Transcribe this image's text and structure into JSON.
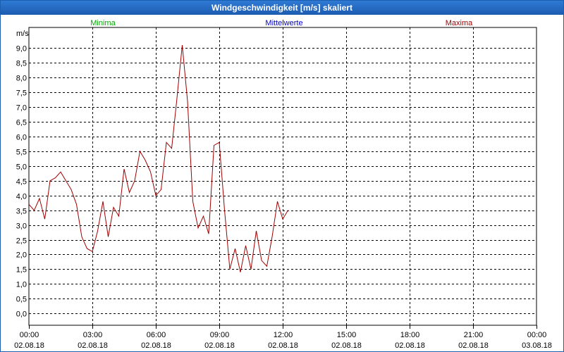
{
  "window": {
    "title": "Windgeschwindigkeit [m/s] skaliert"
  },
  "chart_data": {
    "type": "line",
    "title": "Windgeschwindigkeit [m/s] skaliert",
    "ylabel": "m/s",
    "xlabel": "",
    "ylim": [
      -0.4,
      9.7
    ],
    "xlim_hours": [
      0,
      24
    ],
    "grid": true,
    "yticks": [
      {
        "value": 0.0,
        "label": "0,0"
      },
      {
        "value": 0.5,
        "label": "0,5"
      },
      {
        "value": 1.0,
        "label": "1,0"
      },
      {
        "value": 1.5,
        "label": "1,5"
      },
      {
        "value": 2.0,
        "label": "2,0"
      },
      {
        "value": 2.5,
        "label": "2,5"
      },
      {
        "value": 3.0,
        "label": "3,0"
      },
      {
        "value": 3.5,
        "label": "3,5"
      },
      {
        "value": 4.0,
        "label": "4,0"
      },
      {
        "value": 4.5,
        "label": "4,5"
      },
      {
        "value": 5.0,
        "label": "5,0"
      },
      {
        "value": 5.5,
        "label": "5,5"
      },
      {
        "value": 6.0,
        "label": "6,0"
      },
      {
        "value": 6.5,
        "label": "6,5"
      },
      {
        "value": 7.0,
        "label": "7,0"
      },
      {
        "value": 7.5,
        "label": "7,5"
      },
      {
        "value": 8.0,
        "label": "8,0"
      },
      {
        "value": 8.5,
        "label": "8,5"
      },
      {
        "value": 9.0,
        "label": "9,0"
      }
    ],
    "xticks": [
      {
        "hour": 0,
        "time": "00:00",
        "date": "02.08.18"
      },
      {
        "hour": 3,
        "time": "03:00",
        "date": "02.08.18"
      },
      {
        "hour": 6,
        "time": "06:00",
        "date": "02.08.18"
      },
      {
        "hour": 9,
        "time": "09:00",
        "date": "02.08.18"
      },
      {
        "hour": 12,
        "time": "12:00",
        "date": "02.08.18"
      },
      {
        "hour": 15,
        "time": "15:00",
        "date": "02.08.18"
      },
      {
        "hour": 18,
        "time": "18:00",
        "date": "02.08.18"
      },
      {
        "hour": 21,
        "time": "21:00",
        "date": "02.08.18"
      },
      {
        "hour": 24,
        "time": "00:00",
        "date": "03.08.18"
      }
    ],
    "legend": [
      "Minima",
      "Mittelwerte",
      "Maxima"
    ],
    "series": [
      {
        "name": "Maxima",
        "color": "#a00000",
        "points": [
          [
            0.0,
            3.7
          ],
          [
            0.25,
            3.5
          ],
          [
            0.5,
            3.9
          ],
          [
            0.75,
            3.2
          ],
          [
            1.0,
            4.5
          ],
          [
            1.25,
            4.6
          ],
          [
            1.5,
            4.8
          ],
          [
            1.75,
            4.5
          ],
          [
            2.0,
            4.2
          ],
          [
            2.25,
            3.7
          ],
          [
            2.5,
            2.6
          ],
          [
            2.75,
            2.2
          ],
          [
            3.0,
            2.1
          ],
          [
            3.25,
            2.8
          ],
          [
            3.5,
            3.8
          ],
          [
            3.75,
            2.6
          ],
          [
            4.0,
            3.6
          ],
          [
            4.25,
            3.3
          ],
          [
            4.5,
            4.9
          ],
          [
            4.75,
            4.1
          ],
          [
            5.0,
            4.5
          ],
          [
            5.25,
            5.5
          ],
          [
            5.5,
            5.2
          ],
          [
            5.75,
            4.8
          ],
          [
            6.0,
            4.0
          ],
          [
            6.25,
            4.2
          ],
          [
            6.5,
            5.8
          ],
          [
            6.75,
            5.6
          ],
          [
            7.0,
            7.3
          ],
          [
            7.25,
            9.1
          ],
          [
            7.5,
            7.2
          ],
          [
            7.75,
            3.8
          ],
          [
            8.0,
            2.9
          ],
          [
            8.25,
            3.3
          ],
          [
            8.5,
            2.7
          ],
          [
            8.75,
            5.7
          ],
          [
            9.0,
            5.8
          ],
          [
            9.25,
            3.5
          ],
          [
            9.5,
            1.5
          ],
          [
            9.75,
            2.2
          ],
          [
            10.0,
            1.4
          ],
          [
            10.25,
            2.3
          ],
          [
            10.5,
            1.5
          ],
          [
            10.75,
            2.8
          ],
          [
            11.0,
            1.8
          ],
          [
            11.25,
            1.6
          ],
          [
            11.5,
            2.6
          ],
          [
            11.75,
            3.8
          ],
          [
            12.0,
            3.2
          ],
          [
            12.25,
            3.5
          ]
        ]
      }
    ]
  }
}
